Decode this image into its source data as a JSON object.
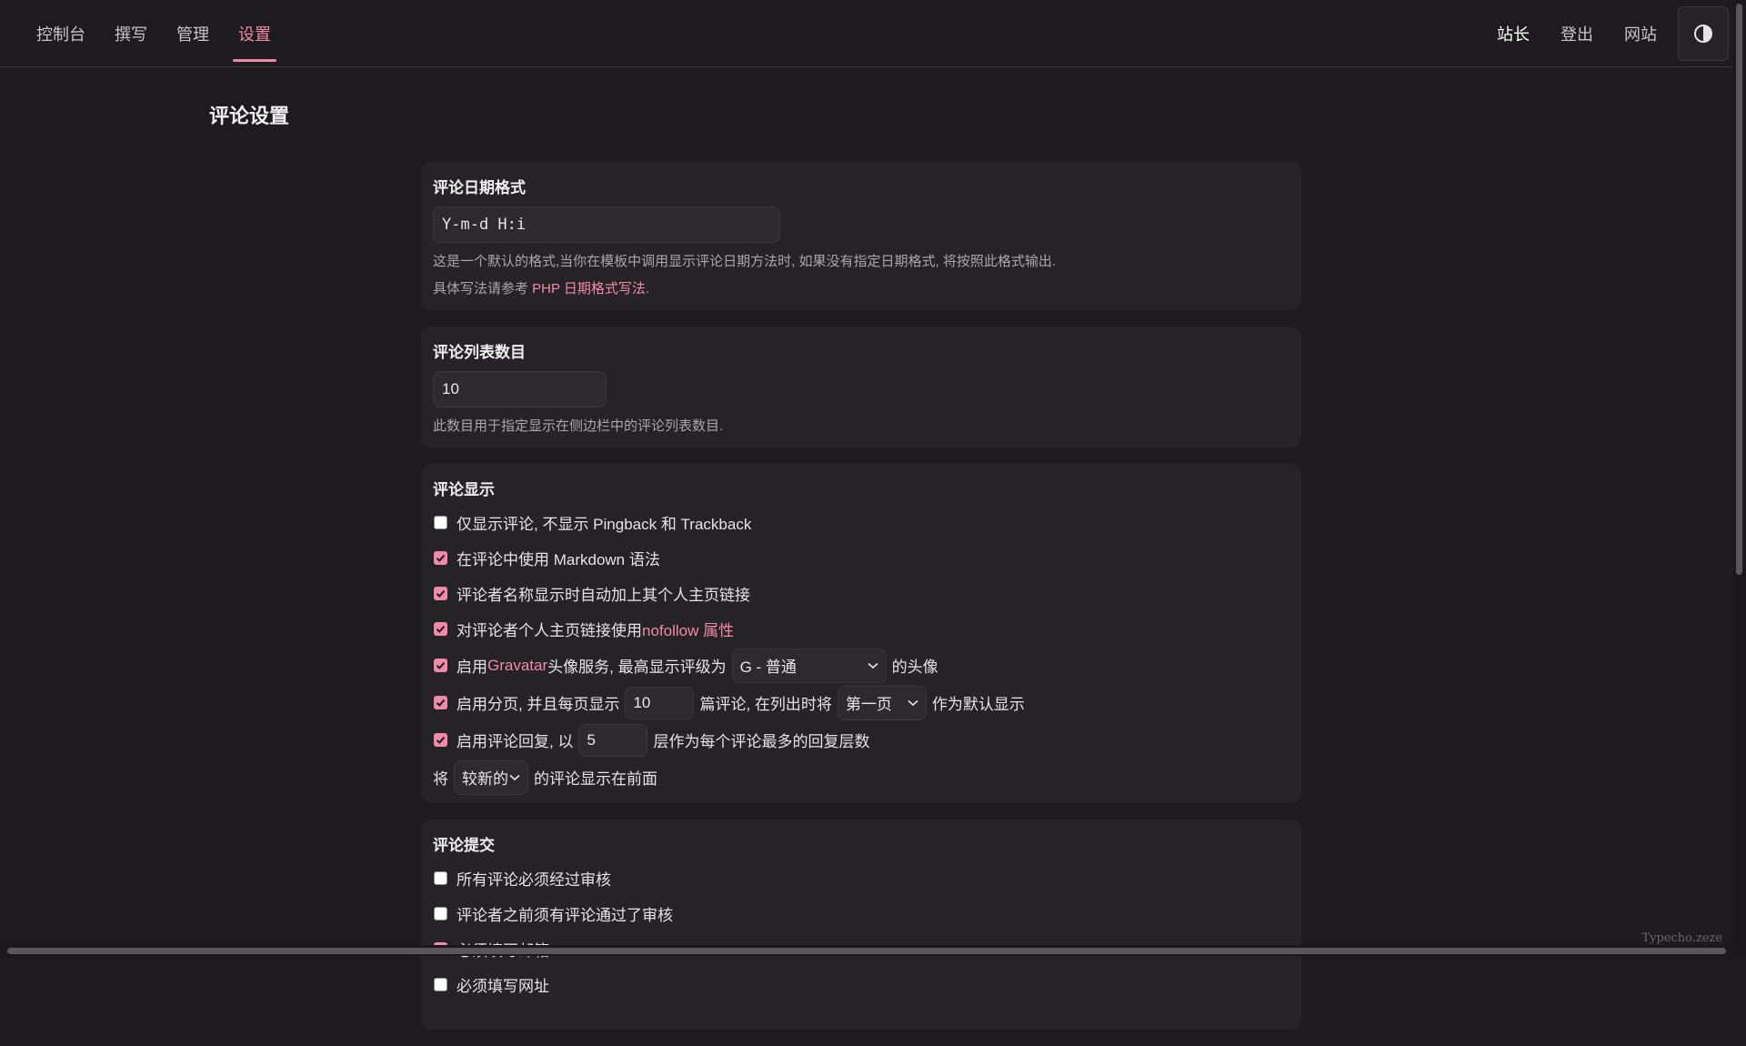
{
  "nav": {
    "left": [
      {
        "label": "控制台"
      },
      {
        "label": "撰写"
      },
      {
        "label": "管理"
      },
      {
        "label": "设置",
        "active": true
      }
    ],
    "right": {
      "owner": "站长",
      "logout": "登出",
      "site": "网站"
    },
    "theme_icon": "contrast-icon"
  },
  "page_title": "评论设置",
  "date_format": {
    "label": "评论日期格式",
    "value": "Y-m-d H:i",
    "desc_line1": "这是一个默认的格式,当你在模板中调用显示评论日期方法时, 如果没有指定日期格式, 将按照此格式输出.",
    "desc_line2_prefix": "具体写法请参考 ",
    "desc_link": "PHP 日期格式写法",
    "desc_line2_suffix": "."
  },
  "list_size": {
    "label": "评论列表数目",
    "value": "10",
    "desc": "此数目用于指定显示在侧边栏中的评论列表数目."
  },
  "display": {
    "label": "评论显示",
    "only_comments": {
      "checked": false,
      "text": "仅显示评论, 不显示 Pingback 和 Trackback"
    },
    "markdown": {
      "checked": true,
      "text": "在评论中使用 Markdown 语法"
    },
    "url_link": {
      "checked": true,
      "text": "评论者名称显示时自动加上其个人主页链接"
    },
    "nofollow": {
      "checked": true,
      "prefix": "对评论者个人主页链接使用 ",
      "link": "nofollow 属性"
    },
    "avatar": {
      "checked": true,
      "prefix": "启用 ",
      "link": "Gravatar",
      "mid": " 头像服务, 最高显示评级为",
      "select": "G - 普通",
      "suffix": "的头像"
    },
    "page_break": {
      "checked": true,
      "prefix": "启用分页, 并且每页显示",
      "value": "10",
      "mid": "篇评论, 在列出时将",
      "select": "第一页",
      "suffix": "作为默认显示"
    },
    "threaded": {
      "checked": true,
      "prefix": "启用评论回复, 以",
      "value": "5",
      "suffix": "层作为每个评论最多的回复层数"
    },
    "order": {
      "prefix": "将",
      "select": "较新的",
      "suffix": "的评论显示在前面"
    }
  },
  "submit": {
    "label": "评论提交",
    "require_moderation": {
      "checked": false,
      "text": "所有评论必须经过审核"
    },
    "whitelist": {
      "checked": false,
      "text": "评论者之前须有评论通过了审核"
    },
    "require_mail": {
      "checked": true,
      "text": "必须填写邮箱"
    },
    "require_url": {
      "checked": false,
      "text": "必须填写网址"
    }
  },
  "watermark": "Typecho.zeze",
  "colors": {
    "accent": "#f08aa6",
    "background": "#1d1b1d",
    "panel": "#262326"
  }
}
